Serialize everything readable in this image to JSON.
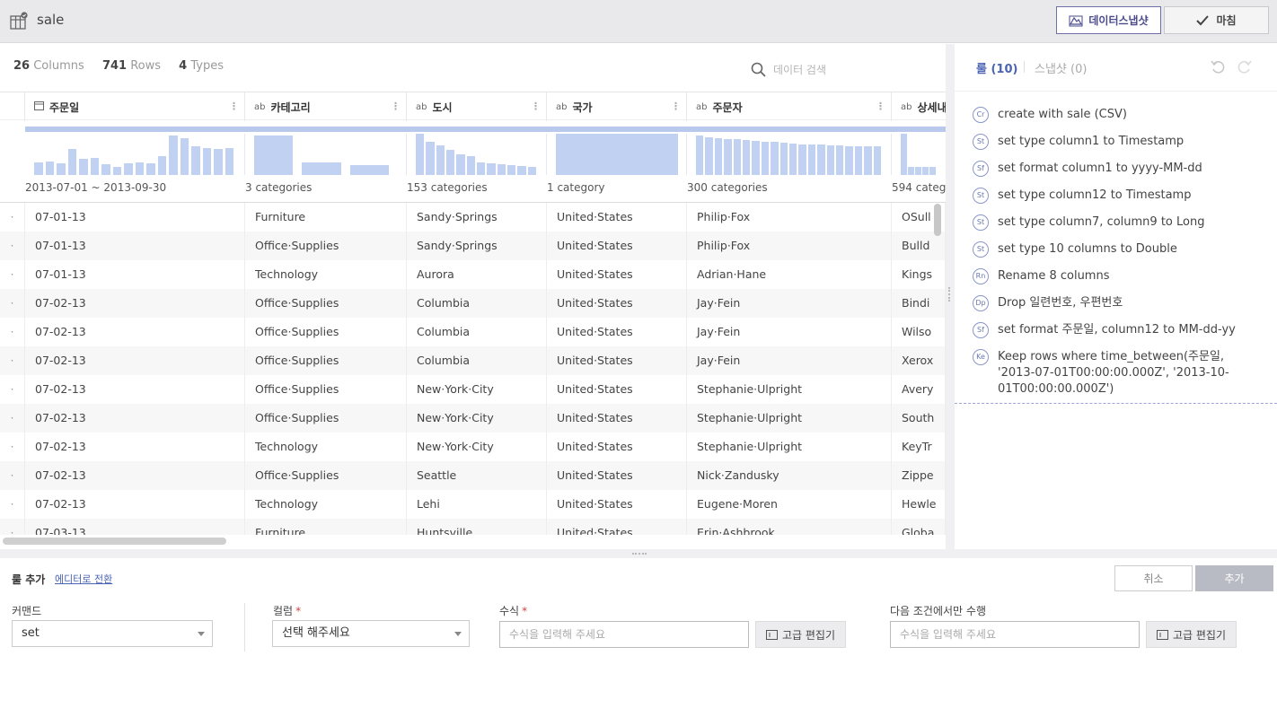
{
  "header": {
    "dataset_name": "sale",
    "snapshot_button": "데이터스냅샷",
    "done_button": "마침"
  },
  "summary": {
    "columns_count": "26",
    "columns_label": "Columns",
    "rows_count": "741",
    "rows_label": "Rows",
    "types_count": "4",
    "types_label": "Types"
  },
  "search": {
    "placeholder": "데이터 검색"
  },
  "columns": [
    {
      "type": "📅",
      "name": "주문일",
      "summary": "2013-07-01 ~ 2013-09-30"
    },
    {
      "type": "ab",
      "name": "카테고리",
      "summary": "3 categories"
    },
    {
      "type": "ab",
      "name": "도시",
      "summary": "153 categories"
    },
    {
      "type": "ab",
      "name": "국가",
      "summary": "1 category"
    },
    {
      "type": "ab",
      "name": "주문자",
      "summary": "300 categories"
    },
    {
      "type": "ab",
      "name": "상세내",
      "summary": "594 categc"
    }
  ],
  "histograms": {
    "date": [
      0.3,
      0.32,
      0.28,
      0.63,
      0.4,
      0.42,
      0.27,
      0.2,
      0.28,
      0.31,
      0.28,
      0.46,
      0.95,
      0.9,
      0.69,
      0.66,
      0.62,
      0.65
    ],
    "category": [
      0.95,
      0.3,
      0.25
    ],
    "city": [
      1.0,
      0.8,
      0.72,
      0.6,
      0.5,
      0.45,
      0.3,
      0.28,
      0.26,
      0.24,
      0.22,
      0.2
    ],
    "country": [
      1.0
    ],
    "customer": [
      0.95,
      0.92,
      0.9,
      0.88,
      0.86,
      0.85,
      0.82,
      0.8,
      0.8,
      0.78,
      0.76,
      0.75,
      0.73,
      0.73,
      0.72,
      0.72,
      0.7,
      0.7,
      0.7,
      0.7
    ],
    "detail": [
      1.0,
      0.2,
      0.2,
      0.2,
      0.2
    ]
  },
  "rows": [
    [
      "07-01-13",
      "Furniture",
      "Sandy·Springs",
      "United·States",
      "Philip·Fox",
      "OSull"
    ],
    [
      "07-01-13",
      "Office·Supplies",
      "Sandy·Springs",
      "United·States",
      "Philip·Fox",
      "Bulld"
    ],
    [
      "07-01-13",
      "Technology",
      "Aurora",
      "United·States",
      "Adrian·Hane",
      "Kings"
    ],
    [
      "07-02-13",
      "Office·Supplies",
      "Columbia",
      "United·States",
      "Jay·Fein",
      "Bindi"
    ],
    [
      "07-02-13",
      "Office·Supplies",
      "Columbia",
      "United·States",
      "Jay·Fein",
      "Wilso"
    ],
    [
      "07-02-13",
      "Office·Supplies",
      "Columbia",
      "United·States",
      "Jay·Fein",
      "Xerox"
    ],
    [
      "07-02-13",
      "Office·Supplies",
      "New·York·City",
      "United·States",
      "Stephanie·Ulpright",
      "Avery"
    ],
    [
      "07-02-13",
      "Office·Supplies",
      "New·York·City",
      "United·States",
      "Stephanie·Ulpright",
      "South"
    ],
    [
      "07-02-13",
      "Technology",
      "New·York·City",
      "United·States",
      "Stephanie·Ulpright",
      "KeyTr"
    ],
    [
      "07-02-13",
      "Office·Supplies",
      "Seattle",
      "United·States",
      "Nick·Zandusky",
      "Zippe"
    ],
    [
      "07-02-13",
      "Technology",
      "Lehi",
      "United·States",
      "Eugene·Moren",
      "Hewle"
    ],
    [
      "07-03-13",
      "Furniture",
      "Huntsville",
      "United·States",
      "Erin·Ashbrook",
      "Globa"
    ]
  ],
  "row_marker": "·",
  "rule_panel": {
    "tab_rules": "룰 (10)",
    "tab_snapshots": "스냅샷 (0)",
    "rules": [
      {
        "badge": "Cr",
        "text": "create with sale (CSV)"
      },
      {
        "badge": "St",
        "text": "set type column1 to Timestamp"
      },
      {
        "badge": "Sf",
        "text": "set format column1 to yyyy-MM-dd"
      },
      {
        "badge": "St",
        "text": "set type column12 to Timestamp"
      },
      {
        "badge": "St",
        "text": "set type column7, column9 to Long"
      },
      {
        "badge": "St",
        "text": "set type 10 columns to Double"
      },
      {
        "badge": "Rn",
        "text": "Rename 8 columns"
      },
      {
        "badge": "Dp",
        "text": "Drop 일련번호, 우편번호"
      },
      {
        "badge": "Sf",
        "text": "set format 주문일, column12 to MM-dd-yy"
      },
      {
        "badge": "Ke",
        "text": "Keep rows where time_between(주문일, '2013-07-01T00:00:00.000Z', '2013-10-01T00:00:00.000Z')"
      }
    ]
  },
  "editor": {
    "title": "룰 추가",
    "switch_link": "에디터로 전환",
    "cancel": "취소",
    "add": "추가",
    "command_label": "커맨드",
    "command_value": "set",
    "column_label": "컬럼",
    "column_value": "선택 해주세요",
    "formula_label": "수식",
    "formula_placeholder": "수식을 입력해 주세요",
    "advanced_editor": "고급 편집기",
    "condition_label": "다음 조건에서만 수행",
    "condition_placeholder": "수식을 입력해 주세요"
  }
}
